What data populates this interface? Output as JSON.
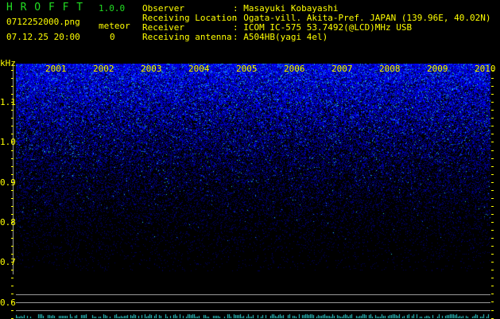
{
  "app": {
    "title": "H R O F F T",
    "version": "1.0.0"
  },
  "file": {
    "name": "0712252000.png",
    "datetime": "07.12.25 20:00",
    "meteor_label": "meteor",
    "meteor_count": "0"
  },
  "info": [
    {
      "label": "Observer",
      "value": ": Masayuki Kobayashi"
    },
    {
      "label": "Receiving Location",
      "value": ": Ogata-vill. Akita-Pref. JAPAN (139.96E, 40.02N)"
    },
    {
      "label": "Receiver",
      "value": ": ICOM IC-575 53.7492(@LCD)MHz USB"
    },
    {
      "label": "Receiving antenna",
      "value": ": A504HB(yagi 4el)"
    }
  ],
  "axis": {
    "unit": "kHz",
    "y_labels": [
      "1.1",
      "1.0",
      "0.9",
      "0.8",
      "0.7",
      "0.6"
    ],
    "x_labels": [
      "2001",
      "2002",
      "2003",
      "2004",
      "2005",
      "2006",
      "2007",
      "2008",
      "2009",
      "2010"
    ]
  },
  "colors": {
    "text": "#ffff00",
    "title": "#22dd22",
    "noise": "#1a1aff",
    "trace": "#33dddd"
  }
}
